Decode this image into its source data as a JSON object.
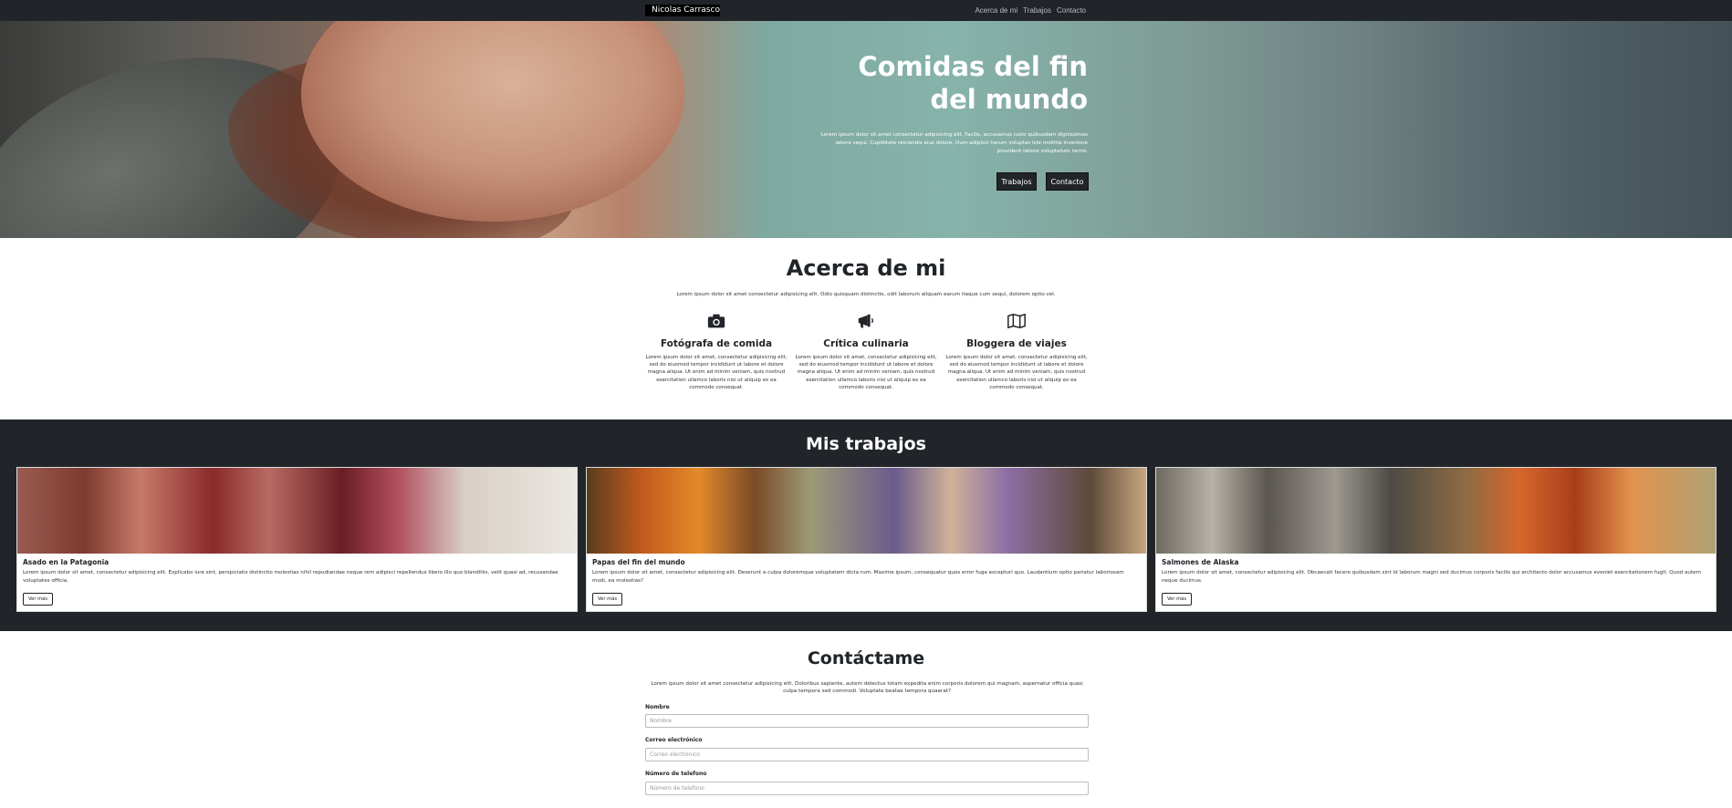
{
  "navbar": {
    "brand": "Nicolas Carrasco",
    "links": [
      "Acerca de mi",
      "Trabajos",
      "Contacto"
    ]
  },
  "hero": {
    "title_line1": "Comidas del fin",
    "title_line2": "del mundo",
    "text": "Lorem ipsum dolor sit amet consectetur adipisicing elit. Facilis, accusamus iusto quibusdam dignissimos labore sequi. Cupiditate reiciendis eius dolore, illum adipisci harum voluptas iste mollitia inventore provident labore voluptatum nemo.",
    "buttons": [
      "Trabajos",
      "Contacto"
    ]
  },
  "about": {
    "title": "Acerca de mi",
    "lead": "Lorem ipsum dolor sit amet consectetur adipisicing elit. Odio quisquam distinctio, odit laborum aliquam earum itaque cum sequi, dolorem optio vel.",
    "services": [
      {
        "icon": "camera-icon",
        "title": "Fotógrafa de comida",
        "text": "Lorem ipsum dolor sit amet, consectetur adipisicing elit, sed do eiusmod tempor incididunt ut labore et dolore magna aliqua. Ut enim ad minim veniam, quis nostrud exercitation ullamco laboris nisi ut aliquip ex ea commodo consequat."
      },
      {
        "icon": "megaphone-icon",
        "title": "Crítica culinaria",
        "text": "Lorem ipsum dolor sit amet, consectetur adipisicing elit, sed do eiusmod tempor incididunt ut labore et dolore magna aliqua. Ut enim ad minim veniam, quis nostrud exercitation ullamco laboris nisi ut aliquip ex ea commodo consequat."
      },
      {
        "icon": "map-icon",
        "title": "Bloggera de viajes",
        "text": "Lorem ipsum dolor sit amet, consectetur adipisicing elit, sed do eiusmod tempor incididunt ut labore et dolore magna aliqua. Ut enim ad minim veniam, quis nostrud exercitation ullamco laboris nisi ut aliquip ex ea commodo consequat."
      }
    ]
  },
  "works": {
    "title": "Mis trabajos",
    "cards": [
      {
        "title": "Asado en la Patagonia",
        "text": "Lorem ipsum dolor sit amet, consectetur adipisicing elit. Explicabo iure sint, perspiciatis distinctio molestias nihil repudiandae neque rem adipisci repellendus libero illo quo blanditiis, velit quasi ad, recusandae voluptates officia.",
        "button": "Ver más"
      },
      {
        "title": "Papas del fin del mundo",
        "text": "Lorem ipsum dolor sit amet, consectetur adipisicing elit. Deserunt a culpa doloremque voluptatem dicta rum. Maxime ipsum, consequatur quos error fuga excepturi quo. Laudantium optio pariatur laboriosam modi, ea molestias?",
        "button": "Ver más"
      },
      {
        "title": "Salmones de Alaska",
        "text": "Lorem ipsum dolor sit amet, consectetur adipisicing elit. Obcaecati facere quibusdam sint id laborum magni sed ducimus corporis facilis qui architecto dolor accusamus eveniet exercitationem fugit. Quod autem neque ducimus.",
        "button": "Ver más"
      }
    ]
  },
  "contact": {
    "title": "Contáctame",
    "lead": "Lorem ipsum dolor sit amet consectetur adipisicing elit. Doloribus sapiente, autem delectus totam expedita enim corporis dolorem qui magnam, aspernatur officia quasi culpa tempora sed commodi. Voluptate beatae tempora quaerat?",
    "fields": [
      {
        "label": "Nombre",
        "placeholder": "Nombre"
      },
      {
        "label": "Correo electrónico",
        "placeholder": "Correo electrónico"
      },
      {
        "label": "Número de telefono",
        "placeholder": "Número de telefono"
      }
    ]
  }
}
